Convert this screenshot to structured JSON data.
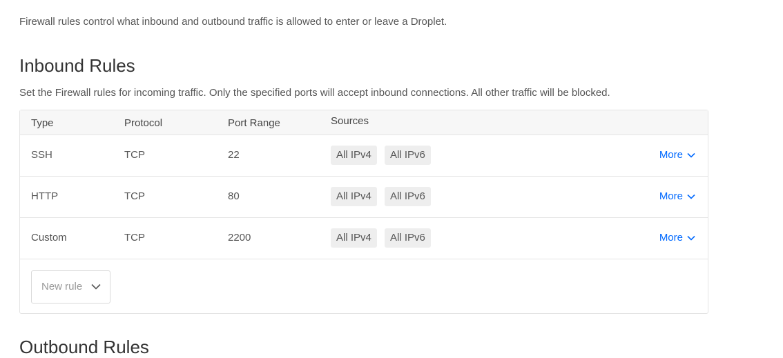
{
  "intro": "Firewall rules control what inbound and outbound traffic is allowed to enter or leave a Droplet.",
  "inbound": {
    "title": "Inbound Rules",
    "description": "Set the Firewall rules for incoming traffic. Only the specified ports will accept inbound connections. All other traffic will be blocked.",
    "columns": {
      "type": "Type",
      "protocol": "Protocol",
      "port_range": "Port Range",
      "sources": "Sources"
    },
    "rows": [
      {
        "type": "SSH",
        "protocol": "TCP",
        "port_range": "22",
        "sources": [
          "All IPv4",
          "All IPv6"
        ],
        "more_label": "More"
      },
      {
        "type": "HTTP",
        "protocol": "TCP",
        "port_range": "80",
        "sources": [
          "All IPv4",
          "All IPv6"
        ],
        "more_label": "More"
      },
      {
        "type": "Custom",
        "protocol": "TCP",
        "port_range": "2200",
        "sources": [
          "All IPv4",
          "All IPv6"
        ],
        "more_label": "More"
      }
    ],
    "new_rule_label": "New rule"
  },
  "outbound": {
    "title": "Outbound Rules"
  },
  "colors": {
    "link": "#0069ff",
    "header_bg": "#f7f7f7",
    "tag_bg": "#eeeeee",
    "border": "#e4e4e4"
  }
}
